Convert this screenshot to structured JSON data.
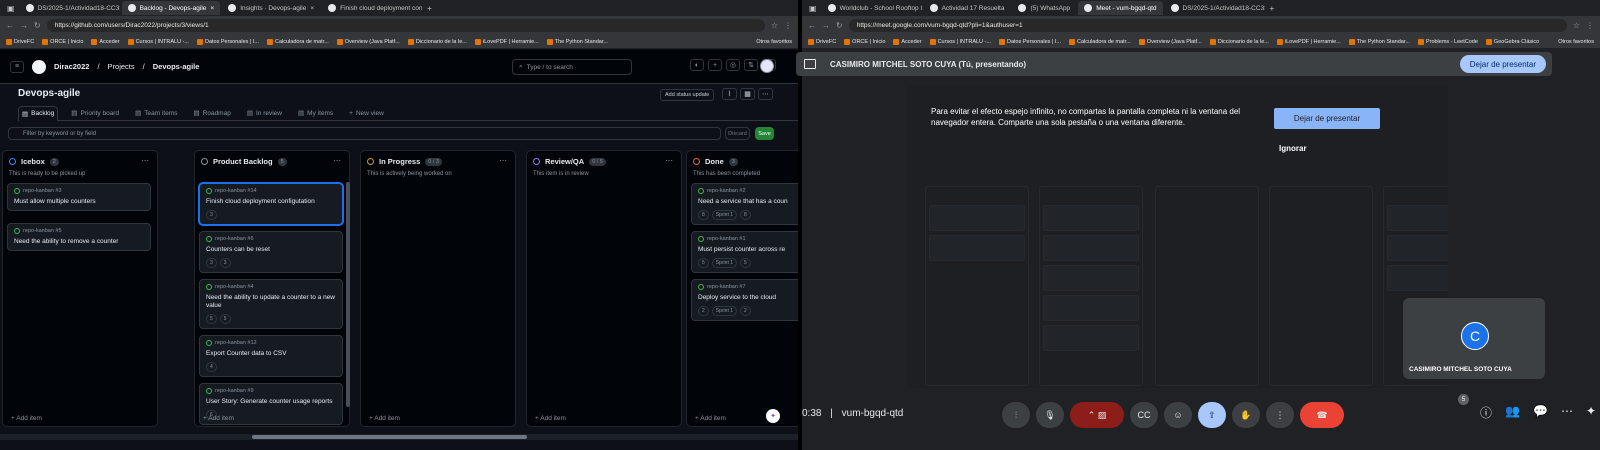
{
  "left": {
    "tabs": [
      {
        "label": "DS/2025-1/Actividad18-CC3S2.m",
        "active": false
      },
      {
        "label": "Backlog - Devops-agile",
        "active": true
      },
      {
        "label": "Insights · Devops-agile",
        "active": false
      },
      {
        "label": "Finish cloud deployment configu",
        "active": false
      }
    ],
    "url": "https://github.com/users/Dirac2022/projects/3/views/1",
    "bookmarks": [
      "DriveFC",
      "ORCE | Inicio",
      "Acceder",
      "Cursos | INTRALU -...",
      "Datos Personales | I...",
      "Calculadora de matr...",
      "Overview (Java Platf...",
      "Diccionario de la le...",
      "iLovePDF | Herramie...",
      "The Python Standar..."
    ],
    "bookmarks_other": "Otros favoritos",
    "header": {
      "user": "Dirac2022",
      "projects": "Projects",
      "project": "Devops-agile",
      "search_placeholder": "Type / to search"
    },
    "project_title": "Devops-agile",
    "status_update": "Add status update",
    "views": [
      "Backlog",
      "Priority board",
      "Team items",
      "Roadmap",
      "In review",
      "My items",
      "New view"
    ],
    "filter_placeholder": "Filter by keyword or by field",
    "discard": "Discard",
    "save": "Save",
    "add_item": "Add item",
    "columns": [
      {
        "name": "Icebox",
        "count": "2",
        "desc": "This is ready to be picked up",
        "color": "#388bfd",
        "cards": [
          {
            "repo": "repo-kanban #3",
            "title": "Must allow multiple counters",
            "tags": []
          },
          {
            "repo": "repo-kanban #5",
            "title": "Need the ability to remove a counter",
            "tags": []
          }
        ]
      },
      {
        "name": "Product Backlog",
        "count": "5",
        "desc": "",
        "color": "#8b949e",
        "cards": [
          {
            "repo": "repo-kanban #14",
            "title": "Finish cloud deployment configutation",
            "tags": [
              "3"
            ],
            "selected": true
          },
          {
            "repo": "repo-kanban #6",
            "title": "Counters can be reset",
            "tags": [
              "3",
              "3"
            ]
          },
          {
            "repo": "repo-kanban #4",
            "title": "Need the ability to update a counter to a new value",
            "tags": [
              "5",
              "5"
            ]
          },
          {
            "repo": "repo-kanban #12",
            "title": "Export Counter data to CSV",
            "tags": [
              "4"
            ]
          },
          {
            "repo": "repo-kanban #9",
            "title": "User Story: Generate counter usage reports",
            "tags": [
              "6"
            ]
          }
        ]
      },
      {
        "name": "In Progress",
        "count": "0 / 3",
        "desc": "This is actively being worked on",
        "color": "#d29922",
        "cards": []
      },
      {
        "name": "Review/QA",
        "count": "0 / 5",
        "desc": "This item is in review",
        "color": "#a371f7",
        "cards": []
      },
      {
        "name": "Done",
        "count": "3",
        "desc": "This has been completed",
        "color": "#db6d28",
        "cards": [
          {
            "repo": "repo-kanban #2",
            "title": "Need a service that has a coun",
            "tags": [
              "8",
              "Sprint 1",
              "8"
            ]
          },
          {
            "repo": "repo-kanban #1",
            "title": "Must persist counter across re",
            "tags": [
              "5",
              "Sprint 1",
              "5"
            ]
          },
          {
            "repo": "repo-kanban #7",
            "title": "Deploy service to the cloud",
            "tags": [
              "2",
              "Sprint 1",
              "2"
            ]
          }
        ]
      }
    ]
  },
  "right": {
    "tabs": [
      "Worldclub - School Rooftop Inter",
      "Actividad 17 Resuelta",
      "(5) WhatsApp",
      "Meet - vum-bgqd-qtd",
      "DS/2025-1/Actividad18-CC3S2"
    ],
    "url": "https://meet.google.com/vum-bgqd-qtd?pli=1&authuser=1",
    "bookmarks": [
      "DriveFC",
      "ORCE | Inicio",
      "Acceder",
      "Cursos | INTRALU -...",
      "Datos Personales | I...",
      "Calculadora de matr...",
      "Overview (Java Platf...",
      "Diccionario de la le...",
      "iLovePDF | Herramie...",
      "The Python Standar...",
      "Problems - LeetCode",
      "GeoGebra Clásico"
    ],
    "bookmarks_other": "Otros favoritos",
    "presenter": "CASIMIRO MITCHEL SOTO CUYA (Tú, presentando)",
    "stop_presenting": "Dejar de presentar",
    "warning": "Para evitar el efecto espejo infinito, no compartas la pantalla completa ni la ventana del navegador entera. Comparte una sola pestaña o una ventana diferente.",
    "warning_button": "Dejar de presentar",
    "ignore": "Ignorar",
    "tile_initial": "C",
    "tile_name": "CASIMIRO MITCHEL SOTO CUYA",
    "time": "0:38",
    "separator": "|",
    "meeting_code": "vum-bgqd-qtd",
    "participants_badge": "5"
  }
}
